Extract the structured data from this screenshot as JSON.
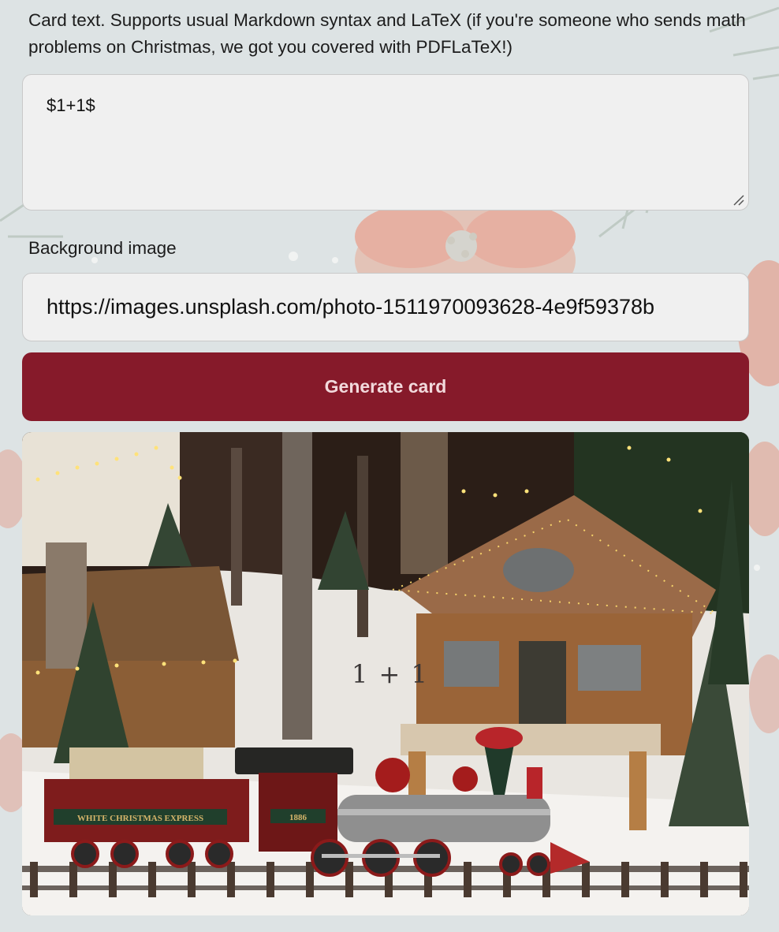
{
  "form": {
    "card_text_label": "Card text. Supports usual Markdown syntax and LaTeX (if you're someone who sends math problems on Christmas, we got you covered with PDFLaTeX!)",
    "card_text_value": "$1+1$",
    "background_label": "Background image",
    "background_value": "https://images.unsplash.com/photo-1511970093628-4e9f59378b",
    "generate_label": "Generate card"
  },
  "preview": {
    "rendered_text": "1 + 1",
    "train_plate_text": "WHITE CHRISTMAS EXPRESS",
    "engine_number": "1886"
  },
  "colors": {
    "accent": "#861a2a",
    "field_bg": "#f0f0f0"
  },
  "icons": [
    "resize-handle-icon"
  ]
}
